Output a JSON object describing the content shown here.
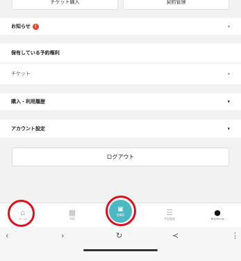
{
  "top_buttons": {
    "ticket_purchase": "チケット購入",
    "contract_manage": "契約管理"
  },
  "notice": {
    "label": "お知らせ",
    "badge": "!"
  },
  "reservations": {
    "heading": "保有している予約権利",
    "ticket_label": "チケット"
  },
  "history": {
    "label": "購入・利用履歴"
  },
  "account": {
    "label": "アカウント設定"
  },
  "logout_label": "ログアウト",
  "tabs": [
    {
      "label": "ホーム",
      "icon": "home-icon"
    },
    {
      "label": "予約",
      "icon": "calendar-icon"
    },
    {
      "label": "会員証",
      "icon": "qr-code-icon"
    },
    {
      "label": "予定管理",
      "icon": "list-icon"
    },
    {
      "label": "マイページ",
      "icon": "user-icon"
    }
  ],
  "colors": {
    "accent": "#4bb8c4",
    "badge": "#e8472b",
    "highlight_ring": "#e0101a"
  }
}
